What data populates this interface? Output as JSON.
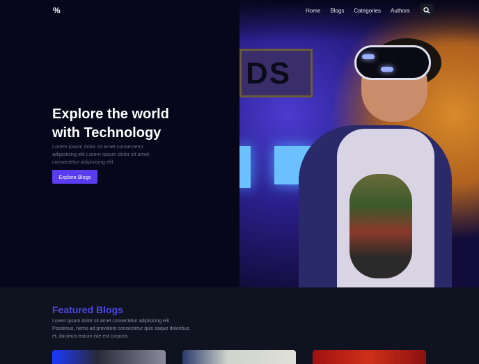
{
  "header": {
    "logo": "%",
    "nav": [
      {
        "label": "Home"
      },
      {
        "label": "Blogs"
      },
      {
        "label": "Categories"
      },
      {
        "label": "Authors"
      }
    ],
    "search_icon": "search-icon"
  },
  "hero": {
    "title": "Explore the world with Technology",
    "subtitle": "Lorem ipsum dolor sit amet consectetur adipisicing elit Lorem ipsum dolor sit amet consectetur adipisicing elit",
    "button": "Explore Blogs",
    "sign_text": "DS"
  },
  "featured": {
    "title": "Featured Blogs",
    "description": "Lorem ipsum dolor sit amet consectetur adipisicing elit. Possimus, nemo ad provident consectetur quis eaque doloribus et, ducimus earum iste est corporis"
  },
  "colors": {
    "accent": "#5b3df0",
    "heading": "#4f46e5"
  }
}
